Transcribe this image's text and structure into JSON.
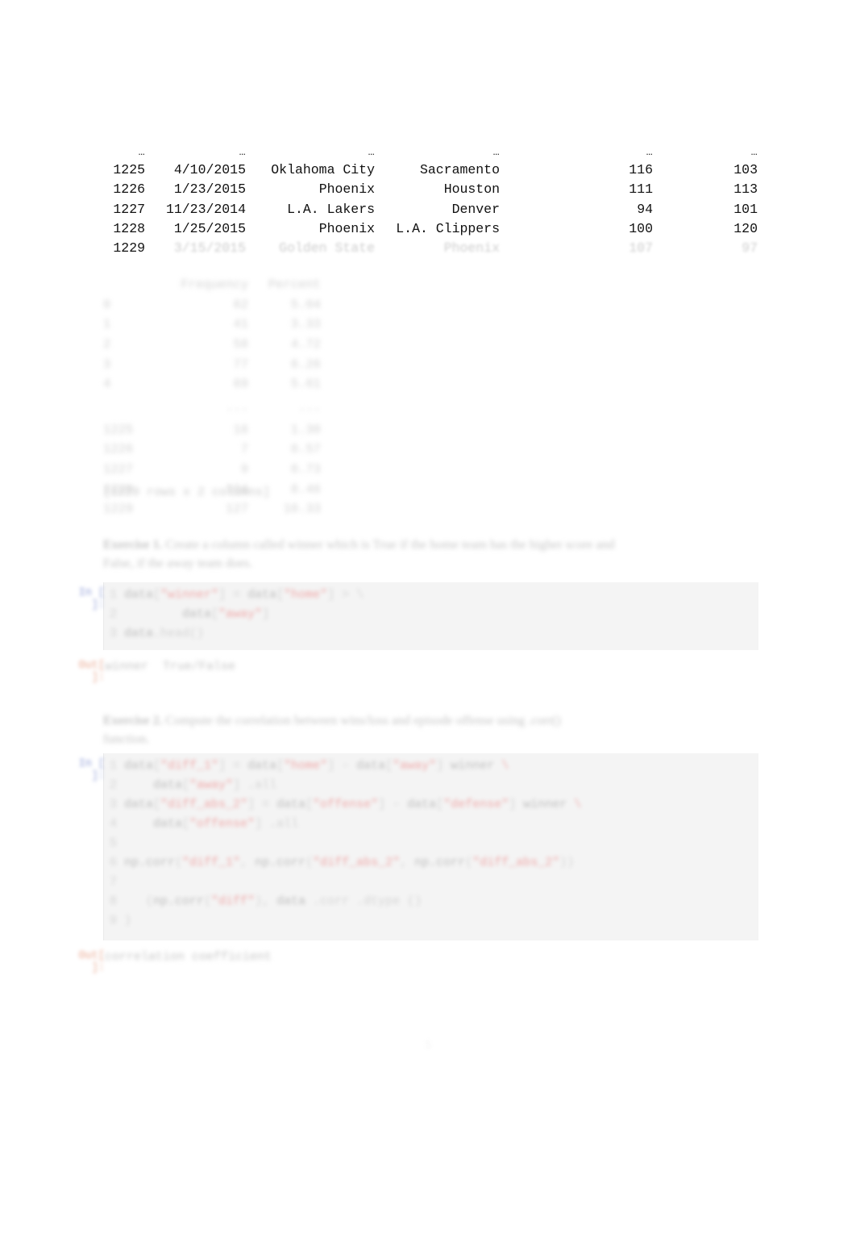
{
  "document": {
    "kind": "jupyter-notebook-pdf-page",
    "page_number": "5"
  },
  "dataframe_top": {
    "header_ellipsis": [
      "…",
      "…",
      "…",
      "…",
      "…",
      "…"
    ],
    "rows": [
      {
        "index": "1225",
        "date": "4/10/2015",
        "team1": "Oklahoma City",
        "team2": "Sacramento",
        "score1": "116",
        "score2": "103"
      },
      {
        "index": "1226",
        "date": "1/23/2015",
        "team1": "Phoenix",
        "team2": "Houston",
        "score1": "111",
        "score2": "113"
      },
      {
        "index": "1227",
        "date": "11/23/2014",
        "team1": "L.A. Lakers",
        "team2": "Denver",
        "score1": "94",
        "score2": "101"
      },
      {
        "index": "1228",
        "date": "1/25/2015",
        "team1": "Phoenix",
        "team2": "L.A. Clippers",
        "score1": "100",
        "score2": "120"
      }
    ],
    "cutoff_row": {
      "index": "1229",
      "date": "3/15/2015",
      "team1": "Golden State",
      "team2": "Phoenix",
      "score1": "107",
      "score2": "97"
    }
  },
  "dataframe_second": {
    "headers": [
      "",
      "Frequency",
      "Percent"
    ],
    "group_a": [
      {
        "label": "0",
        "frequency": "62",
        "percent": "5.04"
      },
      {
        "label": "1",
        "frequency": "41",
        "percent": "3.33"
      },
      {
        "label": "2",
        "frequency": "58",
        "percent": "4.72"
      },
      {
        "label": "3",
        "frequency": "77",
        "percent": "6.26"
      },
      {
        "label": "4",
        "frequency": "69",
        "percent": "5.61"
      }
    ],
    "group_b": [
      {
        "label": "1225",
        "frequency": "16",
        "percent": "1.30"
      },
      {
        "label": "1226",
        "frequency": "7",
        "percent": "0.57"
      },
      {
        "label": "1227",
        "frequency": "9",
        "percent": "0.73"
      },
      {
        "label": "1228",
        "frequency": "104",
        "percent": "8.46"
      },
      {
        "label": "1229",
        "frequency": "127",
        "percent": "10.33"
      }
    ],
    "caption": "[1229 rows x 2 columns]"
  },
  "exercise_1": {
    "label": "Exercise 1.",
    "text_line1": "Create a column called winner which is True if the home team has the higher score and",
    "text_line2": "False, if the away team does."
  },
  "code_cell_1": {
    "prompt": "In [ ]:",
    "lines": [
      {
        "gutter": "1",
        "segments": [
          {
            "t": "code",
            "v": "data"
          },
          {
            "t": "dim",
            "v": "["
          },
          {
            "t": "str",
            "v": "\"winner\""
          },
          {
            "t": "dim",
            "v": "] = "
          },
          {
            "t": "code",
            "v": "data"
          },
          {
            "t": "dim",
            "v": "["
          },
          {
            "t": "str",
            "v": "\"home\""
          },
          {
            "t": "dim",
            "v": "] > \\"
          }
        ]
      },
      {
        "gutter": "2",
        "segments": [
          {
            "t": "dim",
            "v": "        "
          },
          {
            "t": "code",
            "v": "data"
          },
          {
            "t": "dim",
            "v": "["
          },
          {
            "t": "str",
            "v": "\"away\""
          },
          {
            "t": "dim",
            "v": "]"
          }
        ]
      },
      {
        "gutter": "3",
        "segments": [
          {
            "t": "code",
            "v": "data"
          },
          {
            "t": "dim",
            "v": ".head()"
          }
        ]
      }
    ]
  },
  "output_1": {
    "prompt": "Out[ ]:",
    "text": "winner  True/False"
  },
  "exercise_2": {
    "label": "Exercise 2.",
    "text_line1": "Compute the correlation between wins/loss and episode offense using  .corr()",
    "text_line2": "function."
  },
  "code_cell_2": {
    "prompt": "In [ ]:",
    "lines": [
      {
        "gutter": "1",
        "segments": [
          {
            "t": "code",
            "v": "data"
          },
          {
            "t": "dim",
            "v": "["
          },
          {
            "t": "str",
            "v": "\"diff_1\""
          },
          {
            "t": "dim",
            "v": "] = "
          },
          {
            "t": "code",
            "v": "data"
          },
          {
            "t": "dim",
            "v": "["
          },
          {
            "t": "str",
            "v": "\"home\""
          },
          {
            "t": "dim",
            "v": "] - "
          },
          {
            "t": "code",
            "v": "data"
          },
          {
            "t": "dim",
            "v": "["
          },
          {
            "t": "str",
            "v": "\"away\""
          },
          {
            "t": "dim",
            "v": "] "
          },
          {
            "t": "code",
            "v": "winner"
          },
          {
            "t": "dim",
            "v": " \\"
          }
        ]
      },
      {
        "gutter": "2",
        "segments": [
          {
            "t": "dim",
            "v": "    "
          },
          {
            "t": "code",
            "v": "data"
          },
          {
            "t": "dim",
            "v": "["
          },
          {
            "t": "str",
            "v": "\"away\""
          },
          {
            "t": "dim",
            "v": "] .all"
          }
        ]
      },
      {
        "gutter": "3",
        "segments": [
          {
            "t": "code",
            "v": "data"
          },
          {
            "t": "dim",
            "v": "["
          },
          {
            "t": "str",
            "v": "\"diff_abs_2\""
          },
          {
            "t": "dim",
            "v": "] = "
          },
          {
            "t": "code",
            "v": "data"
          },
          {
            "t": "dim",
            "v": "["
          },
          {
            "t": "str",
            "v": "\"offense\""
          },
          {
            "t": "dim",
            "v": "] - "
          },
          {
            "t": "code",
            "v": "data"
          },
          {
            "t": "dim",
            "v": "["
          },
          {
            "t": "str",
            "v": "\"defense\""
          },
          {
            "t": "dim",
            "v": "] "
          },
          {
            "t": "code",
            "v": "winner"
          },
          {
            "t": "dim",
            "v": " \\"
          }
        ]
      },
      {
        "gutter": "4",
        "segments": [
          {
            "t": "dim",
            "v": "    "
          },
          {
            "t": "code",
            "v": "data"
          },
          {
            "t": "dim",
            "v": "["
          },
          {
            "t": "str",
            "v": "\"offense\""
          },
          {
            "t": "dim",
            "v": "] .all"
          }
        ]
      },
      {
        "gutter": "5",
        "segments": [
          {
            "t": "dim",
            "v": ""
          }
        ]
      },
      {
        "gutter": "6",
        "segments": [
          {
            "t": "code",
            "v": "np.corr"
          },
          {
            "t": "dim",
            "v": "("
          },
          {
            "t": "str",
            "v": "\"diff_1\""
          },
          {
            "t": "dim",
            "v": ", "
          },
          {
            "t": "code",
            "v": "np.corr"
          },
          {
            "t": "dim",
            "v": "("
          },
          {
            "t": "str",
            "v": "\"diff_abs_2\""
          },
          {
            "t": "dim",
            "v": ", "
          },
          {
            "t": "code",
            "v": "np.corr"
          },
          {
            "t": "dim",
            "v": "("
          },
          {
            "t": "str",
            "v": "\"diff_abs_2\""
          },
          {
            "t": "dim",
            "v": "))"
          }
        ]
      },
      {
        "gutter": "7",
        "segments": [
          {
            "t": "dim",
            "v": ""
          }
        ]
      },
      {
        "gutter": "8",
        "segments": [
          {
            "t": "dim",
            "v": "   ("
          },
          {
            "t": "code",
            "v": "np.corr"
          },
          {
            "t": "dim",
            "v": "("
          },
          {
            "t": "str",
            "v": "\"diff\""
          },
          {
            "t": "dim",
            "v": "), "
          },
          {
            "t": "code",
            "v": "data"
          },
          {
            "t": "dim",
            "v": " .corr .dtype ()"
          }
        ]
      },
      {
        "gutter": "9",
        "segments": [
          {
            "t": "dim",
            "v": ")"
          }
        ]
      }
    ]
  },
  "output_2": {
    "prompt": "Out[ ]:",
    "text": "correlation coefficient"
  }
}
